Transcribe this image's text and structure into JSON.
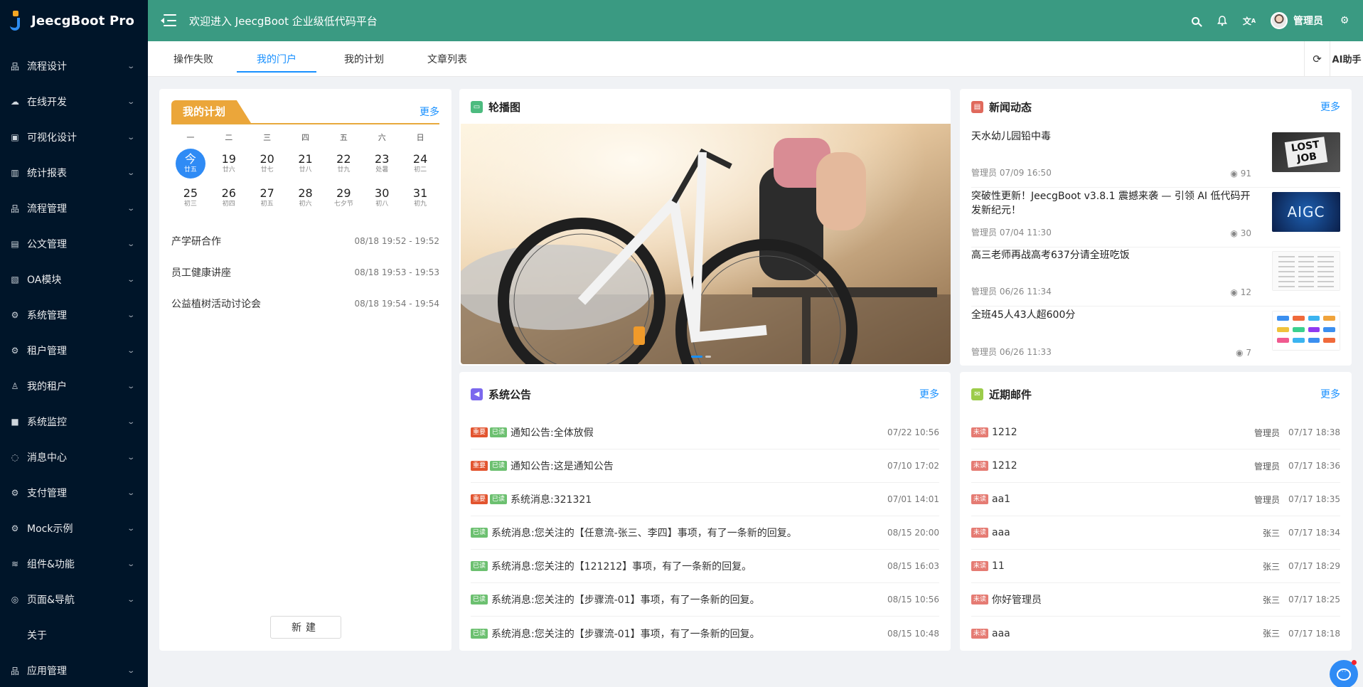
{
  "app": {
    "title": "JeecgBoot Pro"
  },
  "header": {
    "welcome": "欢迎进入 JeecgBoot 企业级低代码平台",
    "username": "管理员"
  },
  "sidebar": {
    "items": [
      {
        "label": "流程设计",
        "icon": "workflow-icon",
        "glyph": "品"
      },
      {
        "label": "在线开发",
        "icon": "cloud-icon",
        "glyph": "☁"
      },
      {
        "label": "可视化设计",
        "icon": "dashboard-icon",
        "glyph": "▣"
      },
      {
        "label": "统计报表",
        "icon": "bar-chart-icon",
        "glyph": "▥"
      },
      {
        "label": "流程管理",
        "icon": "process-icon",
        "glyph": "品"
      },
      {
        "label": "公文管理",
        "icon": "document-icon",
        "glyph": "▤"
      },
      {
        "label": "OA模块",
        "icon": "form-icon",
        "glyph": "▧"
      },
      {
        "label": "系统管理",
        "icon": "setting-icon",
        "glyph": "⚙"
      },
      {
        "label": "租户管理",
        "icon": "tenant-icon",
        "glyph": "⚙"
      },
      {
        "label": "我的租户",
        "icon": "user-icon",
        "glyph": "♙"
      },
      {
        "label": "系统监控",
        "icon": "video-icon",
        "glyph": "■"
      },
      {
        "label": "消息中心",
        "icon": "message-icon",
        "glyph": "◌"
      },
      {
        "label": "支付管理",
        "icon": "payment-icon",
        "glyph": "⚙"
      },
      {
        "label": "Mock示例",
        "icon": "mock-icon",
        "glyph": "⚙"
      },
      {
        "label": "组件&功能",
        "icon": "layers-icon",
        "glyph": "≋"
      },
      {
        "label": "页面&导航",
        "icon": "page-icon",
        "glyph": "◎"
      },
      {
        "label": "关于",
        "icon": "",
        "glyph": ""
      },
      {
        "label": "应用管理",
        "icon": "app-icon",
        "glyph": "品"
      }
    ]
  },
  "tabs": {
    "items": [
      "操作失败",
      "我的门户",
      "我的计划",
      "文章列表"
    ],
    "active": "我的门户",
    "ai_label": "AI助手"
  },
  "plan": {
    "title": "我的计划",
    "more": "更多",
    "weekdays": [
      "一",
      "二",
      "三",
      "四",
      "五",
      "六",
      "日"
    ],
    "days": [
      {
        "num": "今",
        "lunar": "廿五",
        "today": true
      },
      {
        "num": "19",
        "lunar": "廿六"
      },
      {
        "num": "20",
        "lunar": "廿七"
      },
      {
        "num": "21",
        "lunar": "廿八"
      },
      {
        "num": "22",
        "lunar": "廿九"
      },
      {
        "num": "23",
        "lunar": "处暑"
      },
      {
        "num": "24",
        "lunar": "初二"
      },
      {
        "num": "25",
        "lunar": "初三"
      },
      {
        "num": "26",
        "lunar": "初四"
      },
      {
        "num": "27",
        "lunar": "初五"
      },
      {
        "num": "28",
        "lunar": "初六"
      },
      {
        "num": "29",
        "lunar": "七夕节"
      },
      {
        "num": "30",
        "lunar": "初八"
      },
      {
        "num": "31",
        "lunar": "初九"
      }
    ],
    "events": [
      {
        "title": "产学研合作",
        "time": "08/18 19:52 - 19:52"
      },
      {
        "title": "员工健康讲座",
        "time": "08/18 19:53 - 19:53"
      },
      {
        "title": "公益植树活动讨论会",
        "time": "08/18 19:54 - 19:54"
      }
    ],
    "new_button": "新建"
  },
  "carousel": {
    "title": "轮播图",
    "icon_color": "#4cbb7f"
  },
  "news": {
    "title": "新闻动态",
    "more": "更多",
    "icon_color": "#e0695c",
    "items": [
      {
        "title": "天水幼儿园铅中毒",
        "author": "管理员",
        "date": "07/09 16:50",
        "views": "91",
        "thumb_text": "LOST JOB",
        "thumb": "lost-job"
      },
      {
        "title": "突破性更新！JeecgBoot v3.8.1 震撼来袭 — 引领 AI 低代码开发新纪元！",
        "author": "管理员",
        "date": "07/04 11:30",
        "views": "30",
        "thumb_text": "AIGC",
        "thumb": "aigc"
      },
      {
        "title": "高三老师再战高考637分请全班吃饭",
        "author": "管理员",
        "date": "06/26 11:34",
        "views": "12",
        "thumb_text": "",
        "thumb": "list"
      },
      {
        "title": "全班45人43人超600分",
        "author": "管理员",
        "date": "06/26 11:33",
        "views": "7",
        "thumb_text": "",
        "thumb": "apps"
      }
    ]
  },
  "notice": {
    "title": "系统公告",
    "more": "更多",
    "icon_color": "#7b68ee",
    "items": [
      {
        "badges": [
          "重要",
          "已读"
        ],
        "text": "通知公告:全体放假",
        "time": "07/22 10:56"
      },
      {
        "badges": [
          "重要",
          "已读"
        ],
        "text": "通知公告:这是通知公告",
        "time": "07/10 17:02"
      },
      {
        "badges": [
          "重要",
          "已读"
        ],
        "text": "系统消息:321321",
        "time": "07/01 14:01"
      },
      {
        "badges": [
          "已读"
        ],
        "text": "系统消息:您关注的【任意流-张三、李四】事项，有了一条新的回复。",
        "time": "08/15 20:00"
      },
      {
        "badges": [
          "已读"
        ],
        "text": "系统消息:您关注的【121212】事项，有了一条新的回复。",
        "time": "08/15 16:03"
      },
      {
        "badges": [
          "已读"
        ],
        "text": "系统消息:您关注的【步骤流-01】事项，有了一条新的回复。",
        "time": "08/15 10:56"
      },
      {
        "badges": [
          "已读"
        ],
        "text": "系统消息:您关注的【步骤流-01】事项，有了一条新的回复。",
        "time": "08/15 10:48"
      }
    ]
  },
  "mail": {
    "title": "近期邮件",
    "more": "更多",
    "icon_color": "#9ccc4a",
    "items": [
      {
        "badge": "未读",
        "subject": "1212",
        "sender": "管理员",
        "time": "07/17 18:38"
      },
      {
        "badge": "未读",
        "subject": "1212",
        "sender": "管理员",
        "time": "07/17 18:36"
      },
      {
        "badge": "未读",
        "subject": "aa1",
        "sender": "管理员",
        "time": "07/17 18:35"
      },
      {
        "badge": "未读",
        "subject": "aaa",
        "sender": "张三",
        "time": "07/17 18:34"
      },
      {
        "badge": "未读",
        "subject": "11",
        "sender": "张三",
        "time": "07/17 18:29"
      },
      {
        "badge": "未读",
        "subject": "你好管理员",
        "sender": "张三",
        "time": "07/17 18:25"
      },
      {
        "badge": "未读",
        "subject": "aaa",
        "sender": "张三",
        "time": "07/17 18:18"
      }
    ]
  },
  "colors": {
    "header_bg": "#3a9a82",
    "sidebar_bg": "#001529",
    "accent": "#1890ff",
    "plan_tag": "#eba63a"
  }
}
